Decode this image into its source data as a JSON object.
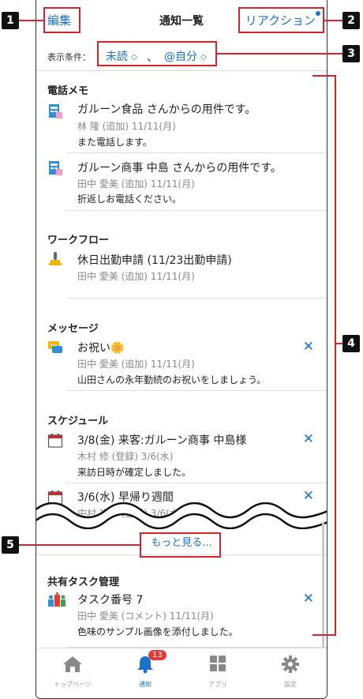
{
  "header": {
    "edit": "編集",
    "title": "通知一覧",
    "reaction": "リアクション"
  },
  "filter": {
    "label": "表示条件：",
    "status": "未読",
    "separator": "、",
    "target": "@自分",
    "chevron": "⌃⌄"
  },
  "sections": [
    {
      "title": "電話メモ",
      "items": [
        {
          "icon": "phone-memo-icon",
          "main": "ガルーン食品 さんからの用件です。",
          "meta": "林 隆 (追加) 11/11(月)",
          "body": "また電話します。"
        },
        {
          "icon": "phone-memo-icon",
          "main": "ガルーン商事 中島 さんからの用件です。",
          "meta": "田中 愛美 (追加) 11/11(月)",
          "body": "折返しお電話ください。"
        }
      ]
    },
    {
      "title": "ワークフロー",
      "items": [
        {
          "icon": "workflow-stamp-icon",
          "main": "休日出勤申請 (11/23出勤申請)",
          "meta": "田中 愛美 (追加) 11/11(月)"
        }
      ]
    },
    {
      "title": "メッセージ",
      "items": [
        {
          "icon": "message-icon",
          "main": "お祝い🌼",
          "meta": "田中 愛美 (追加) 11/11(月)",
          "body": "山田さんの永年勤続のお祝いをしましょう。",
          "close": "✕"
        }
      ]
    },
    {
      "title": "スケジュール",
      "items": [
        {
          "icon": "calendar-icon",
          "main": "3/8(金) 来客:ガルーン商事 中島様",
          "meta": "木村 修 (登録) 3/6(水)",
          "body": "来訪日時が確定しました。",
          "close": "✕"
        },
        {
          "icon": "calendar-icon",
          "main": "3/6(水) 早帰り週間",
          "meta": "中村 裕子 (登録) 3/6(水)",
          "close": "✕"
        }
      ]
    },
    {
      "title": "共有タスク管理",
      "items": [
        {
          "icon": "shared-task-icon",
          "main": "タスク番号 7",
          "meta": "田中 愛美 (コメント) 11/11(月)",
          "body": "色味のサンプル画像を添付しました。",
          "close": "✕"
        }
      ]
    }
  ],
  "more": "もっと見る...",
  "tabs": [
    {
      "label": "トップページ",
      "icon": "home-icon"
    },
    {
      "label": "通知",
      "icon": "bell-icon",
      "badge": "13"
    },
    {
      "label": "アプリ",
      "icon": "apps-icon"
    },
    {
      "label": "設定",
      "icon": "gear-icon"
    }
  ],
  "callouts": [
    "1",
    "2",
    "3",
    "4",
    "5"
  ],
  "colors": {
    "accent": "#1a73c9",
    "callout_frame": "#d9232d",
    "badge": "#e53935"
  }
}
